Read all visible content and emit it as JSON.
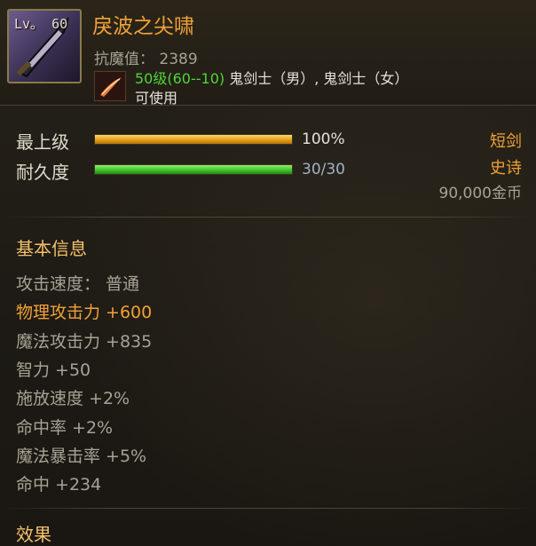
{
  "item": {
    "level_label": "Lv。 60",
    "name": "戾波之尖啸",
    "magic_defense": "抗魔值： 2389",
    "requirement_level": "50级(60--10)",
    "requirement_classes": " 鬼剑士（男）, 鬼剑士（女）",
    "usable": "可使用"
  },
  "bars": {
    "upgrade_label": "最上级",
    "upgrade_value": "100%",
    "upgrade_fraction": 1.0,
    "durability_label": "耐久度",
    "durability_value": "30/30",
    "durability_fraction": 1.0
  },
  "meta": {
    "type": "短剑",
    "rarity": "史诗",
    "price": "90,000金币"
  },
  "basic_info": {
    "title": "基本信息",
    "stats": [
      {
        "text": "攻击速度： 普通",
        "highlight": false
      },
      {
        "text": "物理攻击力 +600",
        "highlight": true
      },
      {
        "text": "魔法攻击力 +835",
        "highlight": false
      },
      {
        "text": "智力 +50",
        "highlight": false
      },
      {
        "text": "施放速度 +2%",
        "highlight": false
      },
      {
        "text": "命中率 +2%",
        "highlight": false
      },
      {
        "text": "魔法暴击率 +5%",
        "highlight": false
      },
      {
        "text": "命中 +234",
        "highlight": false
      }
    ]
  },
  "effects": {
    "title": "效果"
  },
  "colors": {
    "name": "#f0a238",
    "requirement_level": "#4fd53a",
    "section_title": "#f3c06a",
    "highlight_stat": "#f0a238"
  },
  "icons": {
    "item": "dagger-icon",
    "job": "feather-job-icon"
  }
}
